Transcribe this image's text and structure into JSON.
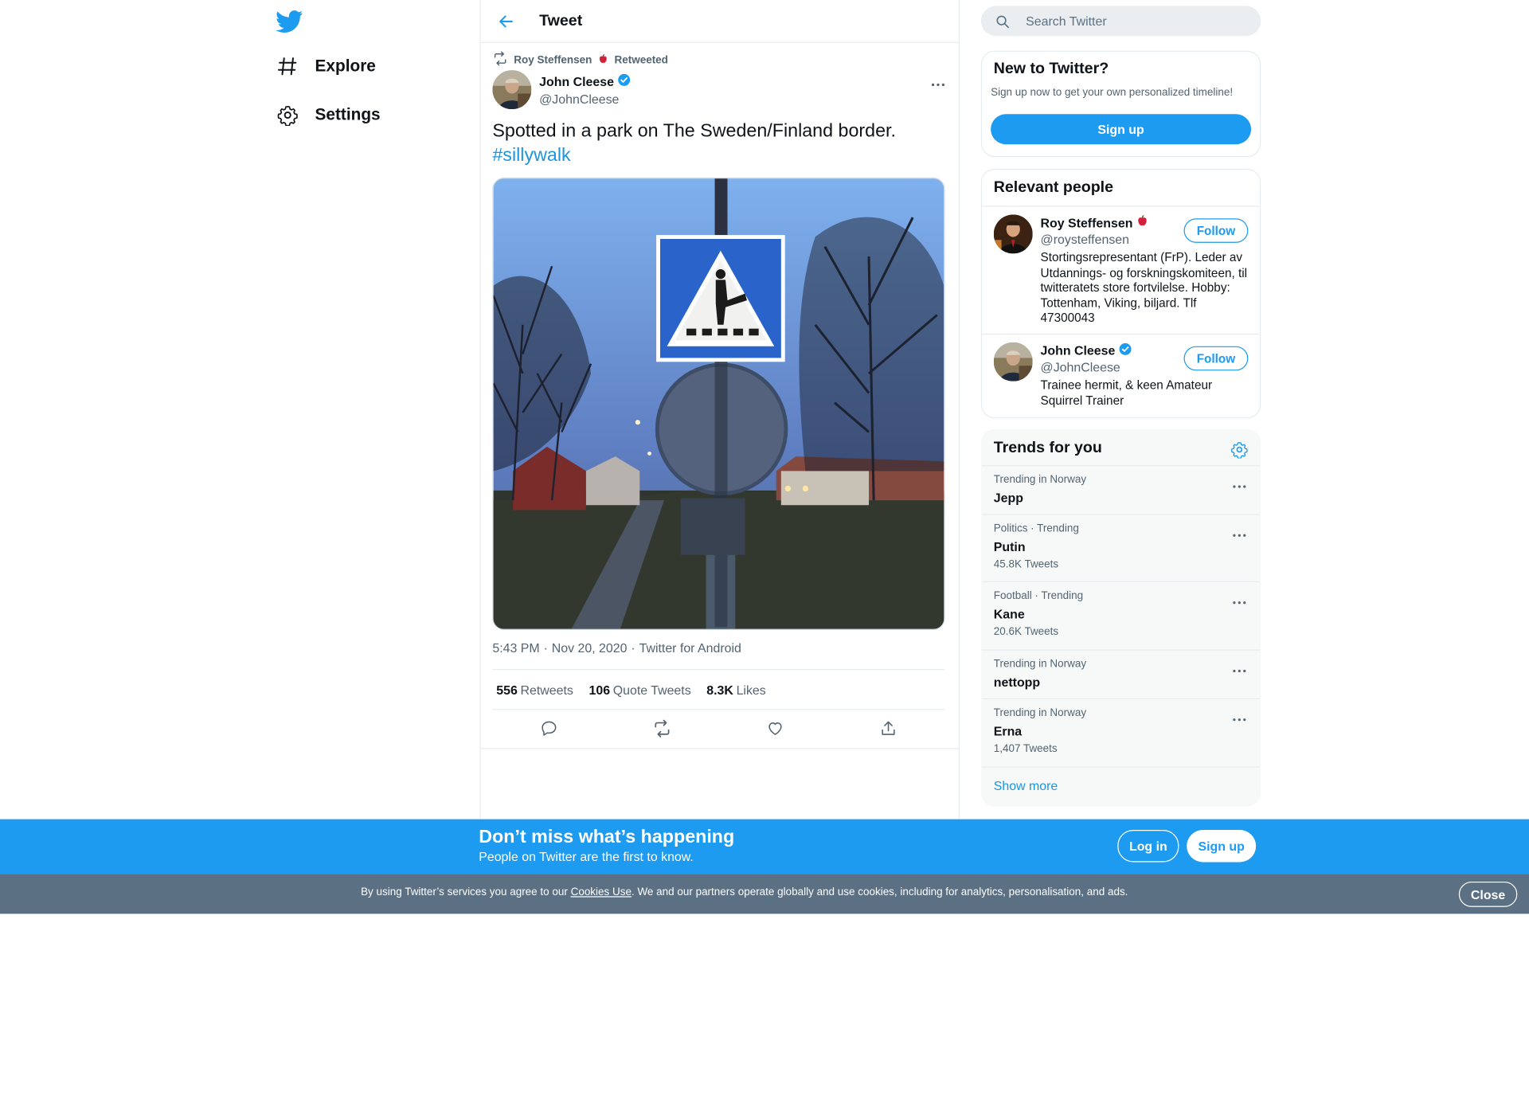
{
  "nav": {
    "logo_icon": "twitter-bird-icon",
    "items": [
      {
        "label": "Explore",
        "icon": "hash-icon"
      },
      {
        "label": "Settings",
        "icon": "gear-icon"
      }
    ]
  },
  "header": {
    "title": "Tweet",
    "back_icon": "arrow-left-icon"
  },
  "tweet": {
    "retweeted_by": "Roy Steffensen",
    "retweeted_label": "Retweeted",
    "author_name": "John Cleese",
    "author_handle": "@JohnCleese",
    "text": "Spotted in a park on The Sweden/Finland border.",
    "hashtag": "#sillywalk",
    "time": "5:43 PM",
    "date": "Nov 20, 2020",
    "source": "Twitter for Android",
    "stats": [
      {
        "count": "556",
        "label": "Retweets"
      },
      {
        "count": "106",
        "label": "Quote Tweets"
      },
      {
        "count": "8.3K",
        "label": "Likes"
      }
    ]
  },
  "search": {
    "placeholder": "Search Twitter"
  },
  "new_to_twitter": {
    "title": "New to Twitter?",
    "subtitle": "Sign up now to get your own personalized timeline!",
    "button": "Sign up"
  },
  "relevant": {
    "title": "Relevant people",
    "people": [
      {
        "name": "Roy Steffensen",
        "handle": "@roysteffensen",
        "bio": "Stortingsrepresentant (FrP). Leder av Utdannings- og forskningskomiteen, til twitteratets store fortvilelse. Hobby: Tottenham, Viking, biljard. Tlf 47300043",
        "follow": "Follow"
      },
      {
        "name": "John Cleese",
        "handle": "@JohnCleese",
        "bio": "Trainee hermit, & keen Amateur Squirrel Trainer",
        "follow": "Follow"
      }
    ]
  },
  "trends": {
    "title": "Trends for you",
    "items": [
      {
        "context": "Trending in Norway",
        "name": "Jepp",
        "count": ""
      },
      {
        "context": "Politics · Trending",
        "name": "Putin",
        "count": "45.8K Tweets"
      },
      {
        "context": "Football · Trending",
        "name": "Kane",
        "count": "20.6K Tweets"
      },
      {
        "context": "Trending in Norway",
        "name": "nettopp",
        "count": ""
      },
      {
        "context": "Trending in Norway",
        "name": "Erna",
        "count": "1,407 Tweets"
      }
    ],
    "show_more": "Show more"
  },
  "banner": {
    "title": "Don’t miss what’s happening",
    "subtitle": "People on Twitter are the first to know.",
    "login": "Log in",
    "signup": "Sign up"
  },
  "cookies": {
    "prefix": "By using Twitter’s services you agree to our ",
    "link": "Cookies Use",
    "suffix": ". We and our partners operate globally and use cookies, including for analytics, personalisation, and ads.",
    "close": "Close"
  },
  "colors": {
    "accent": "#1d9bf0",
    "link": "#1b95e0",
    "cookie_bar": "#5b7083",
    "verified": "#1d9bf0"
  }
}
